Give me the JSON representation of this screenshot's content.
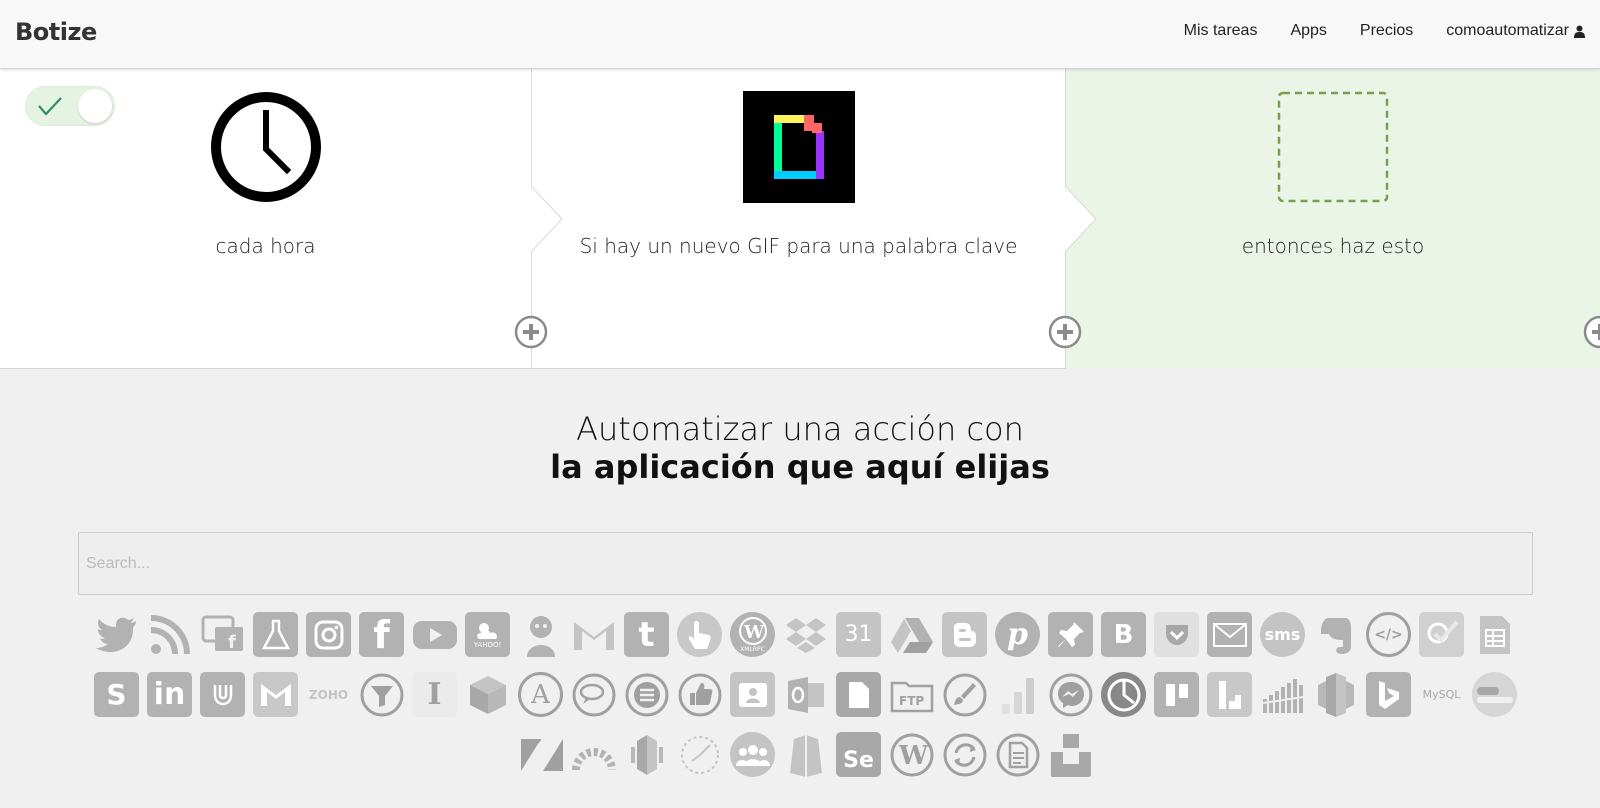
{
  "header": {
    "brand": "Botize",
    "nav": [
      "Mis tareas",
      "Apps",
      "Precios",
      "comoautomatizar"
    ]
  },
  "steps": [
    {
      "label": "cada hora"
    },
    {
      "label": "Si hay un nuevo GIF para una palabra clave"
    },
    {
      "label": "entonces haz esto"
    }
  ],
  "toggle": {
    "state": "on"
  },
  "section": {
    "line1": "Automatizar una acción con",
    "line2": "la aplicación que aquí elijas"
  },
  "search": {
    "placeholder": "Search...",
    "value": ""
  },
  "app_icon_text": {
    "yahoo": "YAHOO!",
    "xmlrpc": "XMLRPC",
    "calendar": "31",
    "botize": "B",
    "sms": "sms",
    "code": "</>",
    "s": "S",
    "in": "in",
    "zoho": "ZOHO",
    "ftp": "FTP",
    "mysql": "MySQL",
    "se": "Se"
  },
  "colors": {
    "step3_bg": "#eaf5e8",
    "toggle_bg": "#e4f3e2",
    "toggle_check": "#2c8c6c",
    "dashed_box": "#7a9e4c",
    "app_gray": "#b2b2b2"
  }
}
